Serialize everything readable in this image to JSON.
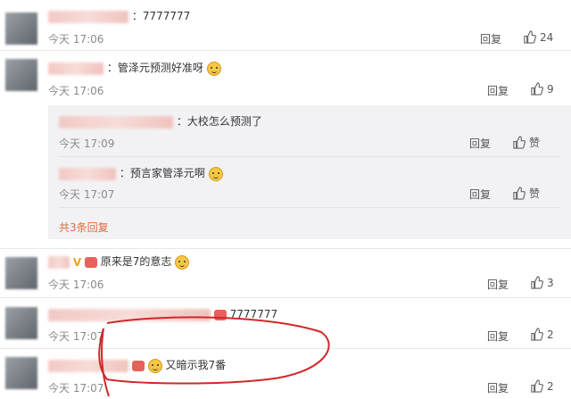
{
  "comments": [
    {
      "text": "：7777777",
      "time": "今天 17:06",
      "reply": "回复",
      "likes": "24"
    },
    {
      "text": "：管泽元预测好准呀",
      "time": "今天 17:06",
      "reply": "回复",
      "likes": "9",
      "replies": [
        {
          "text": "：大校怎么预测了",
          "time": "今天 17:09",
          "reply": "回复",
          "likes": "赞"
        },
        {
          "text": "：预言家管泽元啊",
          "time": "今天 17:07",
          "reply": "回复",
          "likes": "赞"
        }
      ],
      "expand": "共3条回复"
    },
    {
      "text": "原来是7的意志",
      "time": "今天 17:06",
      "reply": "回复",
      "likes": "3"
    },
    {
      "text": "7777777",
      "time": "今天 17:07",
      "reply": "回复",
      "likes": "2"
    },
    {
      "text": "又暗示我7番",
      "time": "今天 17:07",
      "reply": "回复",
      "likes": "2"
    }
  ],
  "colors": {
    "expand": "#e06a3a",
    "annotation": "#d0282a"
  },
  "icons": [
    "thumb-up-icon",
    "smiley-emoji-icon",
    "vip-icon",
    "badge-icon"
  ]
}
